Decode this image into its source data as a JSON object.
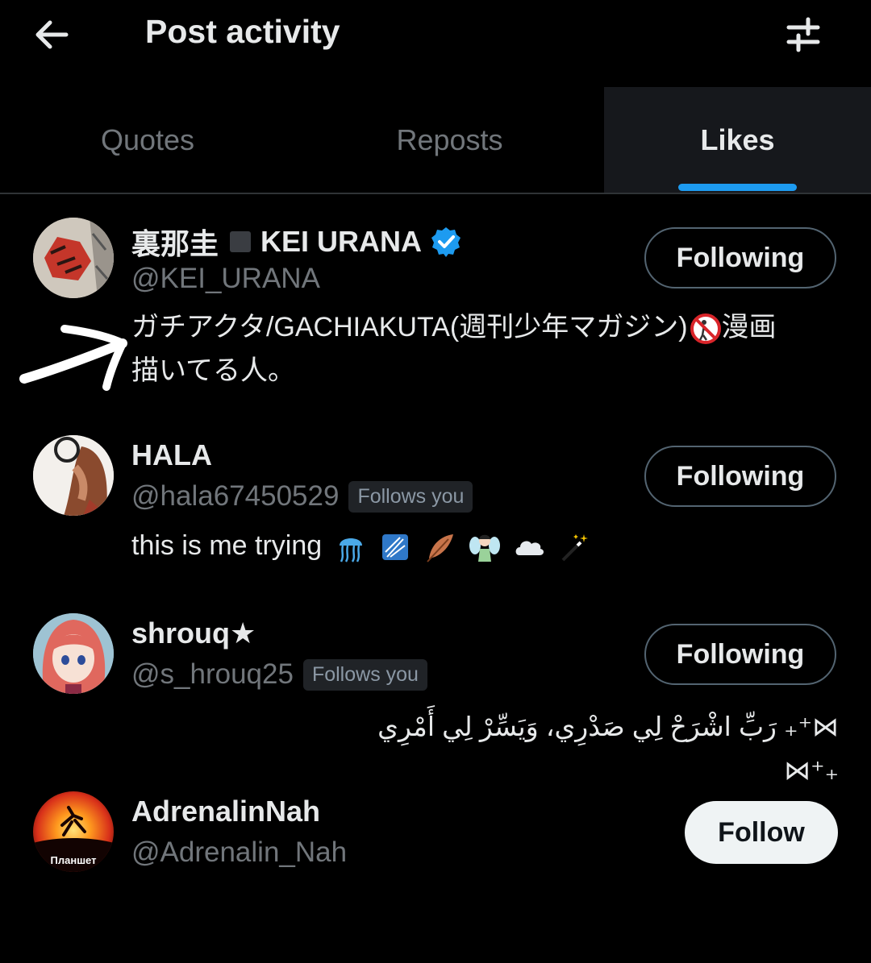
{
  "header": {
    "title": "Post activity"
  },
  "tabs": [
    {
      "label": "Quotes",
      "active": false
    },
    {
      "label": "Reposts",
      "active": false
    },
    {
      "label": "Likes",
      "active": true
    }
  ],
  "colors": {
    "accent": "#1d9bf0",
    "background": "#000000",
    "text_primary": "#e7e9ea",
    "text_secondary": "#71767b"
  },
  "users": [
    {
      "name_jp": "裏那圭",
      "name_en": "KEI URANA",
      "handle": "@KEI_URANA",
      "verified": true,
      "follows_you": false,
      "bio_line1": "ガチアクタ/GACHIAKUTA(週刊少年マガジン)",
      "bio_line1_end": "漫画",
      "bio_line2": "描いてる人。",
      "button": "Following"
    },
    {
      "name": "HALA",
      "handle": "@hala67450529",
      "follows_you": true,
      "follows_label": "Follows you",
      "bio": "this is me trying",
      "bio_emojis": [
        "jellyfish",
        "sparkle-tile",
        "feather",
        "fairy",
        "cloud",
        "magic-wand"
      ],
      "button": "Following"
    },
    {
      "name": "shrouq★",
      "handle": "@s_hrouq25",
      "follows_you": true,
      "follows_label": "Follows you",
      "bio": "⋈⁺₊ رَبِّ اشْرَحْ لِي صَدْرِي، وَيَسِّرْ لِي أَمْرِي ₊⁺⋈",
      "button": "Following"
    },
    {
      "name": "AdrenalinNah",
      "handle": "@Adrenalin_Nah",
      "avatar_text": "Планшет",
      "follows_you": false,
      "button": "Follow"
    }
  ]
}
